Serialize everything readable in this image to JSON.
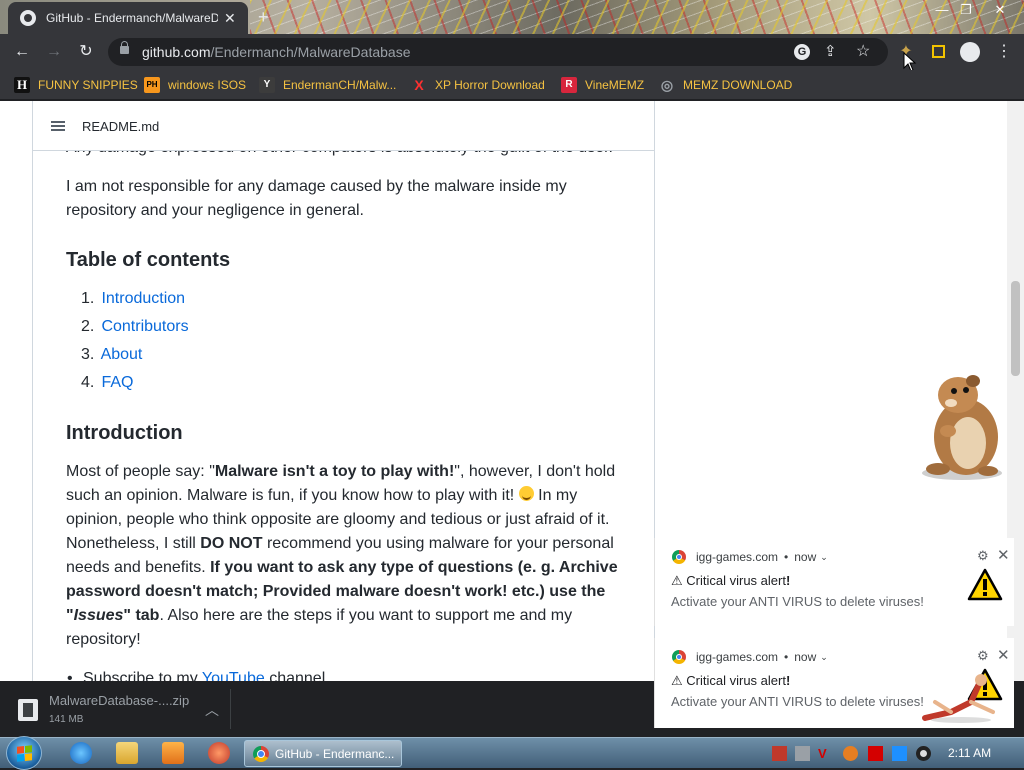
{
  "browser": {
    "tab_title": "GitHub - Endermanch/MalwareDatabase",
    "tab_close": "✕",
    "new_tab": "+",
    "window_controls": [
      "—",
      "❐",
      "✕"
    ],
    "url_host": "github.com",
    "url_path": "/Endermanch/MalwareDatabase"
  },
  "bookmarks": [
    {
      "label": "FUNNY SNIPPIES",
      "icon": "H",
      "color": "#ffffff",
      "bg": "#111111"
    },
    {
      "label": "windows ISOS",
      "icon": "PH",
      "color": "#000000",
      "bg": "#f7971d"
    },
    {
      "label": "EndermanCH/Malw...",
      "icon": "Y",
      "color": "#ffffff",
      "bg": "#3c3c3c"
    },
    {
      "label": "XP Horror Download",
      "icon": "X",
      "color": "#ff3030",
      "bg": "transparent"
    },
    {
      "label": "VineMEMZ",
      "icon": "R",
      "color": "#ffffff",
      "bg": "#d7263d"
    },
    {
      "label": "MEMZ DOWNLOAD",
      "icon": "◎",
      "color": "#9aa0a6",
      "bg": "transparent"
    }
  ],
  "readme": {
    "filename": "README.md",
    "cut_line": "Any damage expressed on other computers is absolutely the guilt of the user.",
    "disclaimer": "I am not responsible for any damage caused by the malware inside my repository and your negligence in general.",
    "toc_heading": "Table of contents",
    "toc": [
      {
        "num": "1.",
        "label": "Introduction"
      },
      {
        "num": "2.",
        "label": "Contributors"
      },
      {
        "num": "3.",
        "label": "About"
      },
      {
        "num": "4.",
        "label": "FAQ"
      }
    ],
    "intro_heading": "Introduction",
    "intro": {
      "p1": "Most of people say: \"",
      "b1": "Malware isn't a toy to play with!",
      "p2": "\", however, I don't hold such an opinion. Malware is fun, if you know how to play with it! ",
      "p3": " In my opinion, people who think opposite are gloomy and tedious or just afraid of it. Nonetheless, I still ",
      "b2": "DO NOT",
      "p4": " recommend you using malware for your personal needs and benefits. ",
      "b3": "If you want to ask any type of questions (e. g. Archive password doesn't match; Provided malware doesn't work! etc.) use the \"",
      "bi": "Issues",
      "b4": "\" tab",
      "p5": ". Also here are the steps if you want to support me and my repository!"
    },
    "bullet_pre": "Subscribe to my ",
    "bullet_link": "YouTube",
    "bullet_post": " channel"
  },
  "notifications": [
    {
      "source": "igg-games.com",
      "time": "now",
      "title": "⚠ Critical virus alert",
      "title_bang": "!",
      "message": "Activate your ANTI VIRUS to delete viruses!"
    },
    {
      "source": "igg-games.com",
      "time": "now",
      "title": "⚠ Critical virus alert",
      "title_bang": "!",
      "message": "Activate your ANTI VIRUS to delete viruses!"
    }
  ],
  "download": {
    "filename": "MalwareDatabase-....zip",
    "size": "141 MB"
  },
  "taskbar": {
    "chrome_label": "GitHub - Endermanc...",
    "clock": "2:11 AM"
  }
}
